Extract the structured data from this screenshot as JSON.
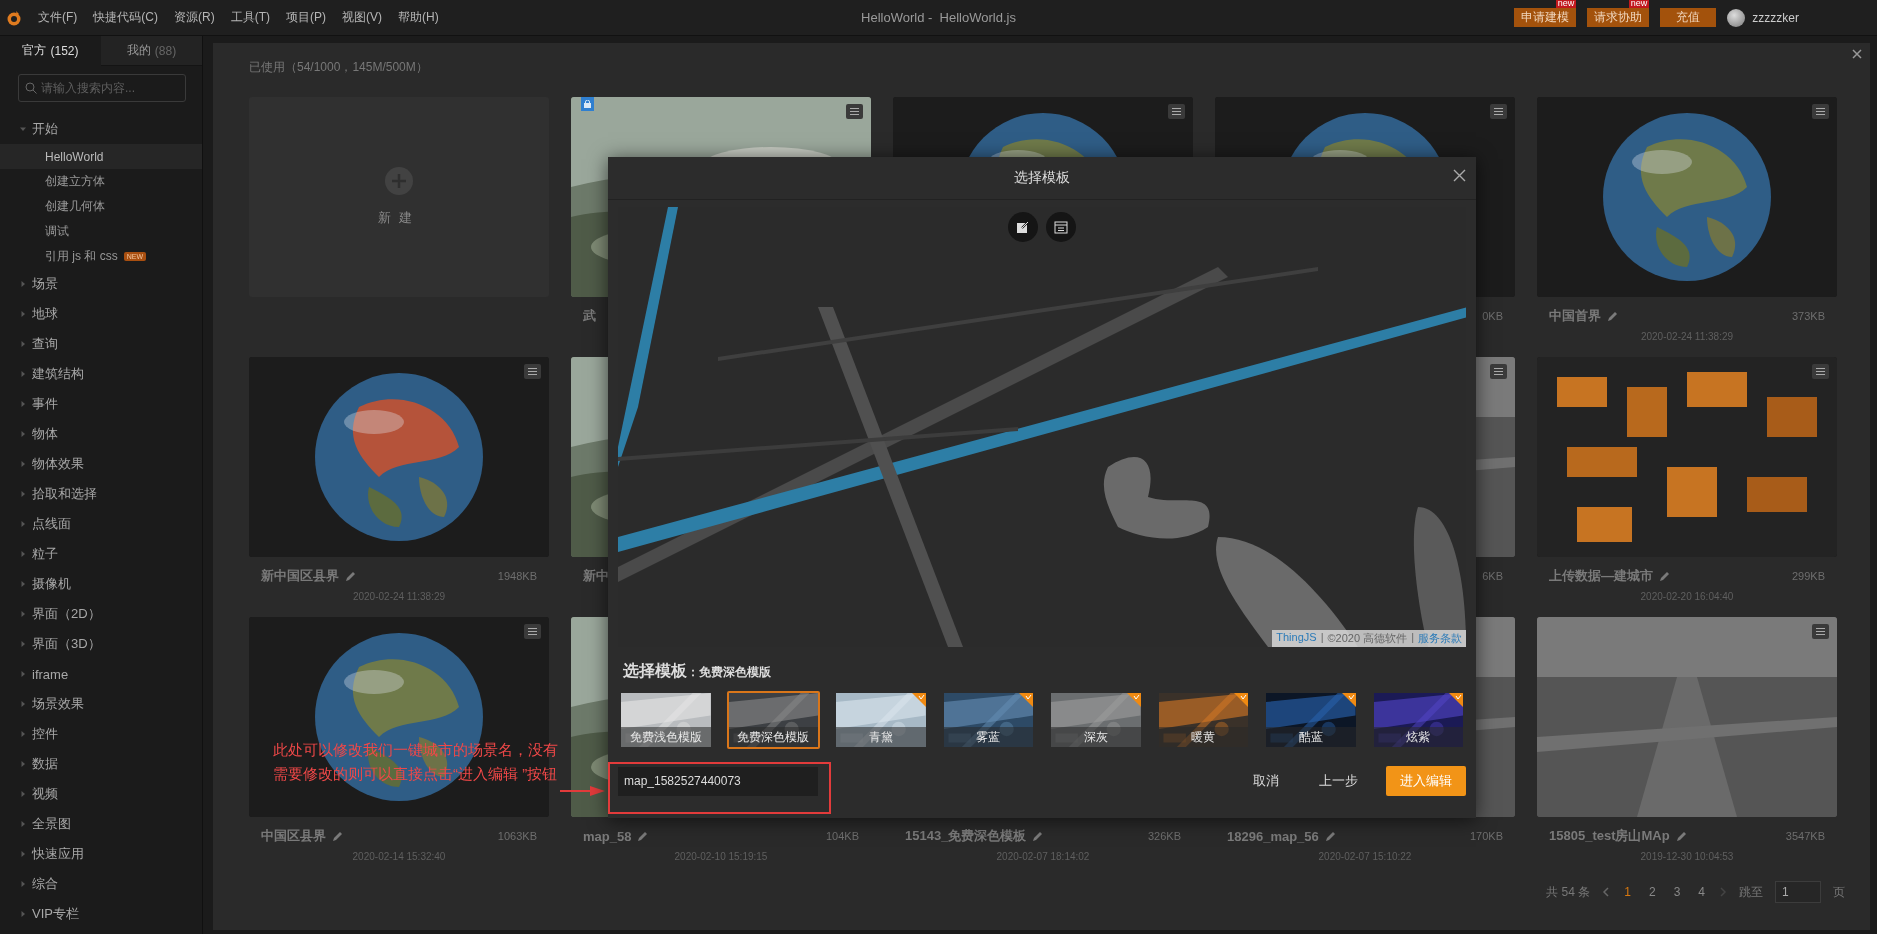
{
  "app": {
    "title": "HelloWorld -  HelloWorld.js",
    "menus": [
      "文件(F)",
      "快捷代码(C)",
      "资源(R)",
      "工具(T)",
      "项目(P)",
      "视图(V)",
      "帮助(H)"
    ],
    "actions": [
      {
        "label": "申请建模",
        "badge": "new"
      },
      {
        "label": "请求协助",
        "badge": "new"
      },
      {
        "label": "充值"
      }
    ],
    "user": "zzzzzker"
  },
  "sidebar": {
    "tabs": [
      {
        "label": "官方",
        "count": "(152)",
        "selected": true
      },
      {
        "label": "我的",
        "count": "(88)",
        "selected": false
      }
    ],
    "search": {
      "placeholder": "请输入搜索内容..."
    },
    "tree": [
      {
        "label": "开始",
        "expanded": true,
        "children": [
          {
            "label": "HelloWorld",
            "selected": true
          },
          {
            "label": "创建立方体",
            "selected": false
          },
          {
            "label": "创建几何体",
            "selected": false
          },
          {
            "label": "调试",
            "selected": false
          },
          {
            "label": "引用 js 和 css",
            "selected": false,
            "badge": "NEW"
          }
        ]
      },
      {
        "label": "场景",
        "expanded": false
      },
      {
        "label": "地球",
        "expanded": false
      },
      {
        "label": "查询",
        "expanded": false
      },
      {
        "label": "建筑结构",
        "expanded": false
      },
      {
        "label": "事件",
        "expanded": false
      },
      {
        "label": "物体",
        "expanded": false
      },
      {
        "label": "物体效果",
        "expanded": false
      },
      {
        "label": "拾取和选择",
        "expanded": false
      },
      {
        "label": "点线面",
        "expanded": false
      },
      {
        "label": "粒子",
        "expanded": false
      },
      {
        "label": "摄像机",
        "expanded": false
      },
      {
        "label": "界面（2D）",
        "expanded": false
      },
      {
        "label": "界面（3D）",
        "expanded": false
      },
      {
        "label": "iframe",
        "expanded": false
      },
      {
        "label": "场景效果",
        "expanded": false
      },
      {
        "label": "控件",
        "expanded": false
      },
      {
        "label": "数据",
        "expanded": false
      },
      {
        "label": "视频",
        "expanded": false
      },
      {
        "label": "全景图",
        "expanded": false
      },
      {
        "label": "快速应用",
        "expanded": false
      },
      {
        "label": "综合",
        "expanded": false
      },
      {
        "label": "VIP专栏",
        "expanded": false
      }
    ]
  },
  "workspace": {
    "usage": "已使用（54/1000，145M/500M）",
    "cards": [
      {
        "kind": "new",
        "label": "新建"
      },
      {
        "kind": "scene",
        "locked": true,
        "menu": true,
        "title": "武"
      },
      {
        "kind": "scene",
        "menu": true
      },
      {
        "kind": "scene",
        "menu": true,
        "size": "0KB"
      },
      {
        "kind": "scene",
        "menu": true,
        "title": "中国首界",
        "size": "373KB",
        "date": "2020-02-24 11:38:29",
        "editable": true
      },
      {
        "kind": "scene",
        "menu": true,
        "title": "新中国区县界",
        "size": "1948KB",
        "date": "2020-02-24 11:38:29",
        "editable": true
      },
      {
        "kind": "scene",
        "title": "新中"
      },
      {
        "kind": "scene"
      },
      {
        "kind": "scene",
        "menu": true,
        "size": "6KB"
      },
      {
        "kind": "scene",
        "menu": true,
        "title": "上传数据—建城市",
        "size": "299KB",
        "date": "2020-02-20 16:04:40",
        "editable": true
      },
      {
        "kind": "scene",
        "menu": true,
        "title": "中国区县界",
        "size": "1063KB",
        "date": "2020-02-14 15:32:40",
        "editable": true
      },
      {
        "kind": "scene",
        "title": "map_58",
        "size": "104KB",
        "date": "2020-02-10 15:19:15",
        "editable": true
      },
      {
        "kind": "scene",
        "title": "15143_免费深色模板",
        "size": "326KB",
        "date": "2020-02-07 18:14:02",
        "editable": true
      },
      {
        "kind": "scene",
        "title": "18296_map_56",
        "size": "170KB",
        "date": "2020-02-07 15:10:22",
        "editable": true
      },
      {
        "kind": "scene",
        "menu": true,
        "title": "15805_test房山MAp",
        "size": "3547KB",
        "date": "2019-12-30 10:04:53",
        "editable": true
      }
    ],
    "pagination": {
      "total": "共 54 条",
      "pages": [
        {
          "label": "1",
          "selected": true
        },
        {
          "label": "2",
          "selected": false
        },
        {
          "label": "3",
          "selected": false
        },
        {
          "label": "4",
          "selected": false
        }
      ],
      "jump_label": "跳至",
      "jump_value": "1",
      "unit": "页"
    }
  },
  "dialog": {
    "title": "选择模板",
    "attribution": [
      {
        "kind": "link",
        "text": "ThingJS"
      },
      {
        "kind": "text",
        "text": "|"
      },
      {
        "kind": "text",
        "text": "©2020 高德软件"
      },
      {
        "kind": "text",
        "text": "|"
      },
      {
        "kind": "link",
        "text": "服务条款"
      }
    ],
    "picker_title": "选择模板",
    "picker_current": "：免费深色模版",
    "templates": [
      {
        "label": "免费浅色模版",
        "selected": false,
        "premium": false
      },
      {
        "label": "免费深色模版",
        "selected": true,
        "premium": false
      },
      {
        "label": "青黛",
        "selected": false,
        "premium": true
      },
      {
        "label": "雾蓝",
        "selected": false,
        "premium": true
      },
      {
        "label": "深灰",
        "selected": false,
        "premium": true
      },
      {
        "label": "暖黄",
        "selected": false,
        "premium": true
      },
      {
        "label": "酷蓝",
        "selected": false,
        "premium": true
      },
      {
        "label": "炫紫",
        "selected": false,
        "premium": true
      }
    ],
    "name_field": {
      "value": "map_1582527440073"
    },
    "buttons": [
      {
        "label": "取消",
        "kind": "text"
      },
      {
        "label": "上一步",
        "kind": "text"
      },
      {
        "label": "进入编辑",
        "kind": "primary"
      }
    ]
  },
  "annotation": {
    "text": "此处可以修改我们一键城市的场景名，没有需要修改的则可以直接点击“进入编辑 ”按钮"
  }
}
